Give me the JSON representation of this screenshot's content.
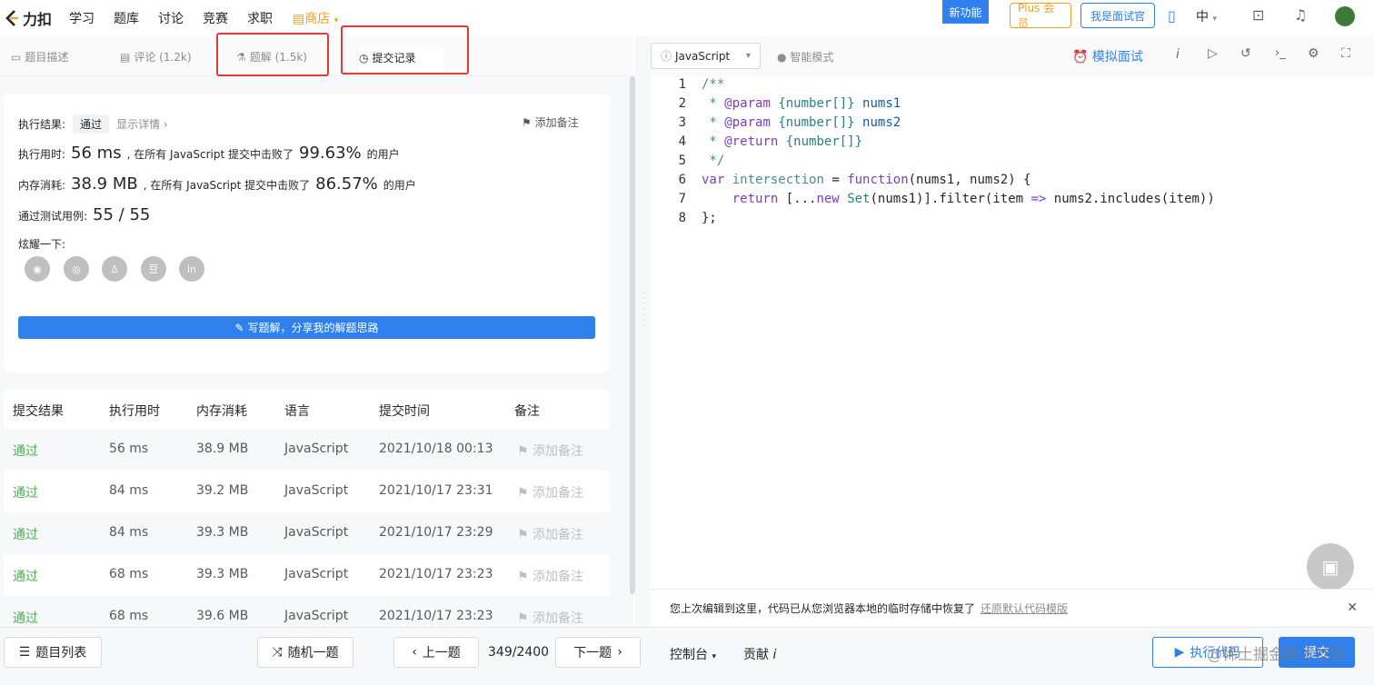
{
  "topnav": {
    "logo_text": "力扣",
    "items": [
      "学习",
      "题库",
      "讨论",
      "竞赛",
      "求职"
    ],
    "shop": "商店",
    "new_feature": "新功能",
    "plus": "Plus 会员",
    "interviewer": "我是面试官",
    "lang": "中"
  },
  "tabs": {
    "desc": "题目描述",
    "comments": "评论 (1.2k)",
    "solutions": "题解 (1.5k)",
    "submissions": "提交记录"
  },
  "result": {
    "status_label": "执行结果:",
    "status": "通过",
    "details": "显示详情 ›",
    "add_note": "添加备注",
    "runtime_label": "执行用时:",
    "runtime": "56 ms",
    "runtime_mid": ", 在所有 JavaScript 提交中击败了",
    "runtime_pct": "99.63%",
    "users": "的用户",
    "memory_label": "内存消耗:",
    "memory": "38.9 MB",
    "memory_mid": ", 在所有 JavaScript 提交中击败了",
    "memory_pct": "86.57%",
    "tests_label": "通过测试用例:",
    "tests": "55 / 55",
    "share_label": "炫耀一下:",
    "write_solution": "写题解，分享我的解题思路"
  },
  "table": {
    "headers": [
      "提交结果",
      "执行用时",
      "内存消耗",
      "语言",
      "提交时间",
      "备注"
    ],
    "rows": [
      {
        "result": "通过",
        "time": "56 ms",
        "mem": "38.9 MB",
        "lang": "JavaScript",
        "date": "2021/10/18 00:13",
        "note": "添加备注"
      },
      {
        "result": "通过",
        "time": "84 ms",
        "mem": "39.2 MB",
        "lang": "JavaScript",
        "date": "2021/10/17 23:31",
        "note": "添加备注"
      },
      {
        "result": "通过",
        "time": "84 ms",
        "mem": "39.3 MB",
        "lang": "JavaScript",
        "date": "2021/10/17 23:29",
        "note": "添加备注"
      },
      {
        "result": "通过",
        "time": "68 ms",
        "mem": "39.3 MB",
        "lang": "JavaScript",
        "date": "2021/10/17 23:23",
        "note": "添加备注"
      },
      {
        "result": "通过",
        "time": "68 ms",
        "mem": "39.6 MB",
        "lang": "JavaScript",
        "date": "2021/10/17 23:23",
        "note": "添加备注"
      }
    ]
  },
  "editor": {
    "language": "JavaScript",
    "smart_mode": "智能模式",
    "mock": "模拟面试",
    "line_numbers": [
      "1",
      "2",
      "3",
      "4",
      "5",
      "6",
      "7",
      "8"
    ]
  },
  "notice": {
    "text": "您上次编辑到这里，代码已从您浏览器本地的临时存储中恢复了",
    "link": "还原默认代码模版"
  },
  "bottom": {
    "problem_list": "题目列表",
    "random": "随机一题",
    "prev": "上一题",
    "page": "349/2400",
    "next": "下一题",
    "console": "控制台",
    "contribute": "贡献",
    "run": "执行代码",
    "submit": "提交"
  },
  "watermark": "@稀土掘金技术社区"
}
